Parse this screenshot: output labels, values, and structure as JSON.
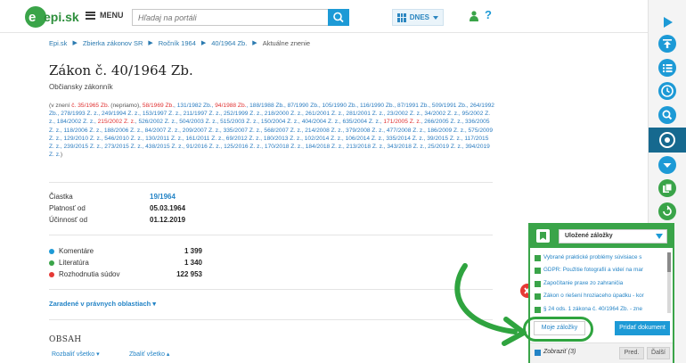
{
  "header": {
    "logo_text": "epi.sk",
    "menu_label": "MENU",
    "search_placeholder": "Hľadaj na portáli",
    "date_label": "DNES"
  },
  "breadcrumb": [
    "Epi.sk",
    "Zbierka zákonov SR",
    "Ročník 1964",
    "40/1964 Zb.",
    "Aktuálne znenie"
  ],
  "title": "Zákon č. 40/1964 Zb.",
  "subtitle": "Občiansky zákonník",
  "amendments": {
    "prefix": "(v znení ",
    "items": [
      {
        "t": "č. 35/1965 Zb.",
        "c": "red"
      },
      {
        "t": " (nepriamo), ",
        "c": "gray"
      },
      {
        "t": "58/1969 Zb.",
        "c": "red"
      },
      {
        "t": ", 131/1982 Zb., ",
        "c": "blue"
      },
      {
        "t": "94/1988 Zb.",
        "c": "red"
      },
      {
        "t": ", 188/1988 Zb., 87/1990 Zb., 105/1990 Zb., 116/1990 Zb., 87/1991 Zb., 509/1991 Zb., 264/1992 Zb., 278/1993 Z. z., 249/1994 Z. z., 153/1997 Z. z., 211/1997 Z. z., 252/1999 Z. z., 218/2000 Z. z., 261/2001 Z. z., 281/2001 Z. z., 23/2002 Z. z., 34/2002 Z. z., 95/2002 Z. z., 184/2002 Z. z., ",
        "c": "blue"
      },
      {
        "t": "215/2002 Z. z.",
        "c": "red"
      },
      {
        "t": ", 526/2002 Z. z., 504/2003 Z. z., 515/2003 Z. z., 150/2004 Z. z., 404/2004 Z. z., 635/2004 Z. z., ",
        "c": "blue"
      },
      {
        "t": "171/2005 Z. z.",
        "c": "red"
      },
      {
        "t": ", 266/2005 Z. z., 336/2005 Z. z., 118/2006 Z. z., 188/2006 Z. z., 84/2007 Z. z., 209/2007 Z. z., 335/2007 Z. z., 568/2007 Z. z., 214/2008 Z. z., 379/2008 Z. z., 477/2008 Z. z., 186/2009 Z. z., 575/2009 Z. z., 129/2010 Z. z., 546/2010 Z. z., 130/2011 Z. z., 161/2011 Z. z., 69/2012 Z. z., 180/2013 Z. z., 102/2014 Z. z., 106/2014 Z. z., 335/2014 Z. z., 39/2015 Z. z., 117/2015 Z. z., 239/2015 Z. z., 273/2015 Z. z., 438/2015 Z. z., 91/2016 Z. z., 125/2016 Z. z., 170/2018 Z. z., 184/2018 Z. z., 213/2018 Z. z., 343/2018 Z. z., 25/2019 Z. z., 394/2019 Z. z.",
        "c": "blue"
      },
      {
        "t": ")",
        "c": "gray"
      }
    ]
  },
  "info": [
    {
      "label": "Čiastka",
      "value": "19/1964",
      "link": true
    },
    {
      "label": "Platnosť od",
      "value": "05.03.1964",
      "link": false
    },
    {
      "label": "Účinnosť od",
      "value": "01.12.2019",
      "link": false
    }
  ],
  "stats": [
    {
      "label": "Komentáre",
      "value": "1 399",
      "color": "#1d9ad6"
    },
    {
      "label": "Literatúra",
      "value": "1 340",
      "color": "#3aa449"
    },
    {
      "label": "Rozhodnutia súdov",
      "value": "122 953",
      "color": "#e53935"
    }
  ],
  "areas_label": "Zaradené v právnych oblastiach ▾",
  "toc_title": "OBSAH",
  "expand_all": "Rozbaliť všetko ▾",
  "collapse_all": "Zbaliť všetko ▴",
  "bookmarks": {
    "select_value": "Uložené záložky",
    "items": [
      "Vybrané praktické problémy súvisiace s",
      "GDPR: Použitie fotografií a videí na mar",
      "Započítanie praxe zo zahraničia",
      "Zákon o riešení hroziaceho úpadku - kor",
      "§ 24 ods. 1 zákona č. 40/1964 Zb. - zne"
    ],
    "my_bookmarks": "Moje záložky",
    "add_document": "Pridať dokument",
    "show_label": "Zobraziť (3)",
    "prev": "Pred.",
    "next": "Ďalší"
  },
  "colors": {
    "accent_blue": "#1d9ad6",
    "bookmark_green": "#3aa449",
    "rail_active": "#16698f",
    "amend_red": "#e03232"
  },
  "rail_icons": [
    "play-icon",
    "upload-icon",
    "list-icon",
    "clock-icon",
    "search-icon",
    "target-icon",
    "chevron-down-icon",
    "bookmarks-icon",
    "history-icon"
  ]
}
